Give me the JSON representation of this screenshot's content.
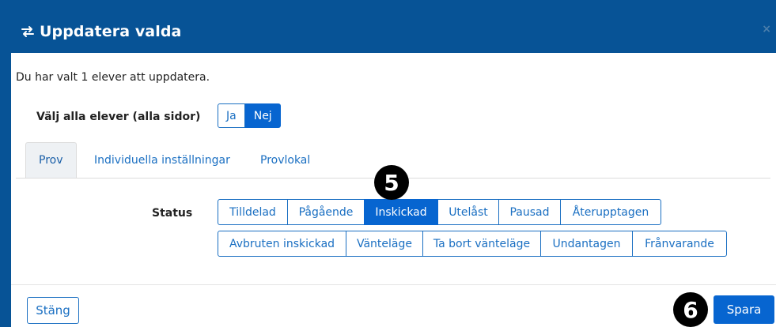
{
  "dialog": {
    "title": "Uppdatera valda",
    "close_symbol": "×",
    "icon": "swap-arrows-icon"
  },
  "intro_text": "Du har valt 1 elever att uppdatera.",
  "select_all": {
    "label": "Välj alla elever (alla sidor)",
    "options": [
      "Ja",
      "Nej"
    ],
    "selected": "Nej"
  },
  "tabs": [
    {
      "label": "Prov",
      "active": true
    },
    {
      "label": "Individuella inställningar",
      "active": false
    },
    {
      "label": "Provlokal",
      "active": false
    }
  ],
  "status": {
    "label": "Status",
    "row1": [
      "Tilldelad",
      "Pågående",
      "Inskickad",
      "Utelåst",
      "Pausad",
      "Återupptagen"
    ],
    "row2": [
      "Avbruten inskickad",
      "Vänteläge",
      "Ta bort vänteläge",
      "Undantagen",
      "Frånvarande"
    ],
    "selected": "Inskickad"
  },
  "footer": {
    "close_label": "Stäng",
    "save_label": "Spara"
  },
  "badges": {
    "step5": "5",
    "step6": "6"
  },
  "colors": {
    "header_bg": "#075396",
    "accent": "#0765d0",
    "link": "#1a6fc2"
  }
}
